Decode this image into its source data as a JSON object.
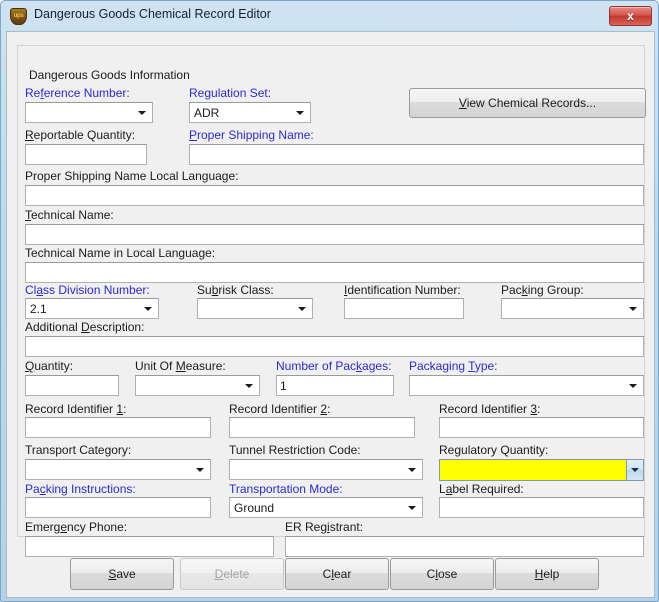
{
  "window": {
    "title": "Dangerous Goods Chemical Record Editor",
    "icon": "ups-shield-icon",
    "close_label": "x",
    "accent_blue": "#2a2ad0",
    "highlight_yellow": "#ffff00"
  },
  "group": {
    "title": "Dangerous Goods Information"
  },
  "actions": {
    "view_chemical_records": "View Chemical Records..."
  },
  "fields": {
    "reference_number": {
      "label": "Reference Number:",
      "mnemonic": "f",
      "value": "",
      "required": true,
      "type": "combobox"
    },
    "regulation_set": {
      "label": "Regulation Set:",
      "mnemonic": "g",
      "value": "ADR",
      "required": true,
      "type": "combobox"
    },
    "reportable_quantity": {
      "label": "Reportable Quantity:",
      "mnemonic": "R",
      "value": "",
      "required": false,
      "type": "textbox"
    },
    "proper_shipping_name": {
      "label": "Proper Shipping Name:",
      "mnemonic": "P",
      "value": "",
      "required": true,
      "type": "textbox"
    },
    "proper_shipping_name_local": {
      "label": "Proper Shipping Name Local Language:",
      "mnemonic": "",
      "value": "",
      "required": false,
      "type": "textbox"
    },
    "technical_name": {
      "label": "Technical Name:",
      "mnemonic": "T",
      "value": "",
      "required": false,
      "type": "textbox"
    },
    "technical_name_local": {
      "label": "Technical Name in Local Language:",
      "mnemonic": "",
      "value": "",
      "required": false,
      "type": "textbox"
    },
    "class_division_number": {
      "label": "Class Division Number:",
      "mnemonic": "a",
      "value": "2.1",
      "required": true,
      "type": "combobox"
    },
    "subrisk_class": {
      "label": "Subrisk Class:",
      "mnemonic": "b",
      "value": "",
      "required": false,
      "type": "combobox"
    },
    "identification_number": {
      "label": "Identification Number:",
      "mnemonic": "I",
      "value": "",
      "required": false,
      "type": "textbox"
    },
    "packing_group": {
      "label": "Packing Group:",
      "mnemonic": "k",
      "value": "",
      "required": false,
      "type": "combobox"
    },
    "additional_description": {
      "label": "Additional Description:",
      "mnemonic": "D",
      "value": "",
      "required": false,
      "type": "textbox"
    },
    "quantity": {
      "label": "Quantity:",
      "mnemonic": "Q",
      "value": "",
      "required": false,
      "type": "textbox"
    },
    "unit_of_measure": {
      "label": "Unit Of Measure:",
      "mnemonic": "M",
      "value": "",
      "required": false,
      "type": "combobox"
    },
    "number_of_packages": {
      "label": "Number of Packages:",
      "mnemonic": "k",
      "value": "1",
      "required": true,
      "type": "textbox"
    },
    "packaging_type": {
      "label": "Packaging Type:",
      "mnemonic": "T",
      "value": "",
      "required": true,
      "type": "combobox"
    },
    "record_identifier_1": {
      "label": "Record Identifier 1:",
      "mnemonic": "1",
      "value": "",
      "required": false,
      "type": "textbox"
    },
    "record_identifier_2": {
      "label": "Record Identifier 2:",
      "mnemonic": "2",
      "value": "",
      "required": false,
      "type": "textbox"
    },
    "record_identifier_3": {
      "label": "Record Identifier 3:",
      "mnemonic": "3",
      "value": "",
      "required": false,
      "type": "textbox"
    },
    "transport_category": {
      "label": "Transport Category:",
      "mnemonic": "",
      "value": "",
      "required": false,
      "type": "combobox"
    },
    "tunnel_restriction_code": {
      "label": "Tunnel Restriction Code:",
      "mnemonic": "",
      "value": "",
      "required": false,
      "type": "combobox"
    },
    "regulatory_quantity": {
      "label": "Regulatory Quantity:",
      "mnemonic": "",
      "value": "",
      "required": false,
      "type": "combobox",
      "highlighted": true
    },
    "packing_instructions": {
      "label": "Packing Instructions:",
      "mnemonic": "c",
      "value": "",
      "required": true,
      "type": "textbox"
    },
    "transportation_mode": {
      "label": "Transportation Mode:",
      "mnemonic": "",
      "value": "Ground",
      "required": true,
      "type": "combobox"
    },
    "label_required": {
      "label": "Label Required:",
      "mnemonic": "a",
      "value": "",
      "required": false,
      "type": "textbox"
    },
    "emergency_phone": {
      "label": "Emergency Phone:",
      "mnemonic": "e",
      "value": "",
      "required": false,
      "type": "textbox"
    },
    "er_registrant": {
      "label": "ER Registrant:",
      "mnemonic": "i",
      "value": "",
      "required": false,
      "type": "textbox"
    }
  },
  "buttons": {
    "save": {
      "label": "Save",
      "enabled": true
    },
    "delete": {
      "label": "Delete",
      "enabled": false
    },
    "clear": {
      "label": "Clear",
      "enabled": true
    },
    "close": {
      "label": "Close",
      "enabled": true
    },
    "help": {
      "label": "Help",
      "enabled": true
    }
  }
}
